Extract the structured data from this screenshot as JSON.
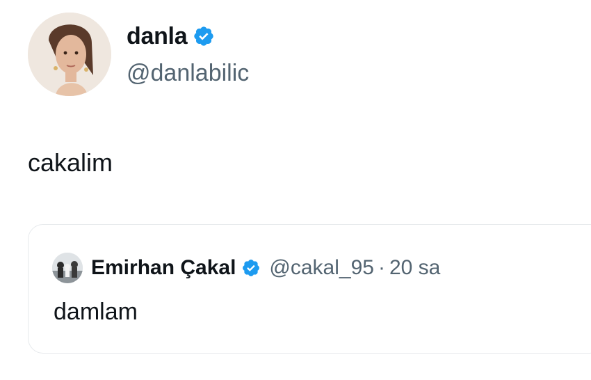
{
  "tweet": {
    "author": {
      "display_name": "danla",
      "handle": "@danlabilic",
      "verified": true,
      "avatar_icon": "profile-photo"
    },
    "text": "cakalim",
    "quoted_tweet": {
      "author": {
        "display_name": "Emirhan Çakal",
        "handle": "@cakal_95",
        "verified": true,
        "avatar_icon": "profile-photo"
      },
      "separator": "·",
      "time": "20 sa",
      "text": "damlam"
    }
  },
  "colors": {
    "verified_blue": "#1d9bf0",
    "text_primary": "#0f1419",
    "text_secondary": "#536471",
    "border": "#e6e9ec"
  }
}
